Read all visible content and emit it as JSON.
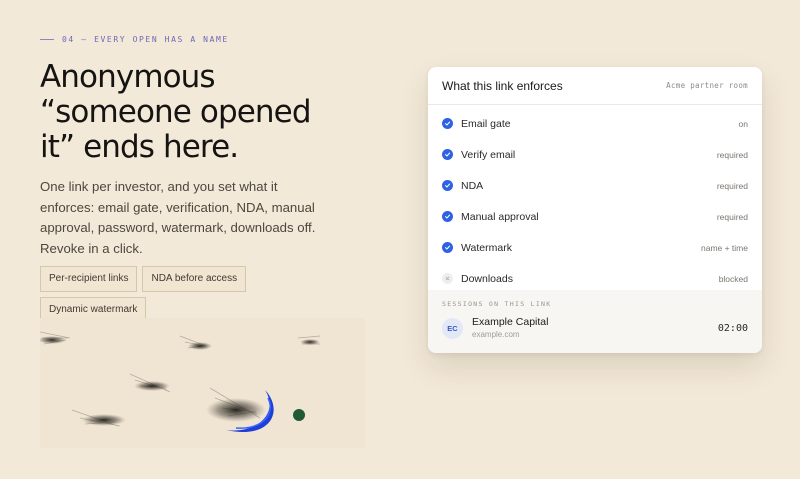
{
  "hero": {
    "eyebrow": "04 — EVERY OPEN HAS A NAME",
    "headline": "Anonymous “someone opened it” ends here.",
    "lede": "One link per investor, and you set what it enforces: email gate, verification, NDA, manual approval, password, watermark, downloads off. Revoke in a click.",
    "chips": [
      "Per-recipient links",
      "NDA before access",
      "Dynamic watermark"
    ]
  },
  "card": {
    "title": "What this link enforces",
    "room": "Acme partner room",
    "rules": [
      {
        "label": "Email gate",
        "value": "on",
        "enabled": true
      },
      {
        "label": "Verify email",
        "value": "required",
        "enabled": true
      },
      {
        "label": "NDA",
        "value": "required",
        "enabled": true
      },
      {
        "label": "Manual approval",
        "value": "required",
        "enabled": true
      },
      {
        "label": "Watermark",
        "value": "name + time",
        "enabled": true
      },
      {
        "label": "Downloads",
        "value": "blocked",
        "enabled": false
      }
    ],
    "sessions": {
      "label": "SESSIONS ON THIS LINK",
      "items": [
        {
          "initials": "EC",
          "name": "Example Capital",
          "domain": "example.com",
          "time": "02:00"
        }
      ]
    }
  },
  "colors": {
    "background": "#f3e9d8",
    "accent": "#2f62e3",
    "eyebrow": "#6f67b8"
  }
}
